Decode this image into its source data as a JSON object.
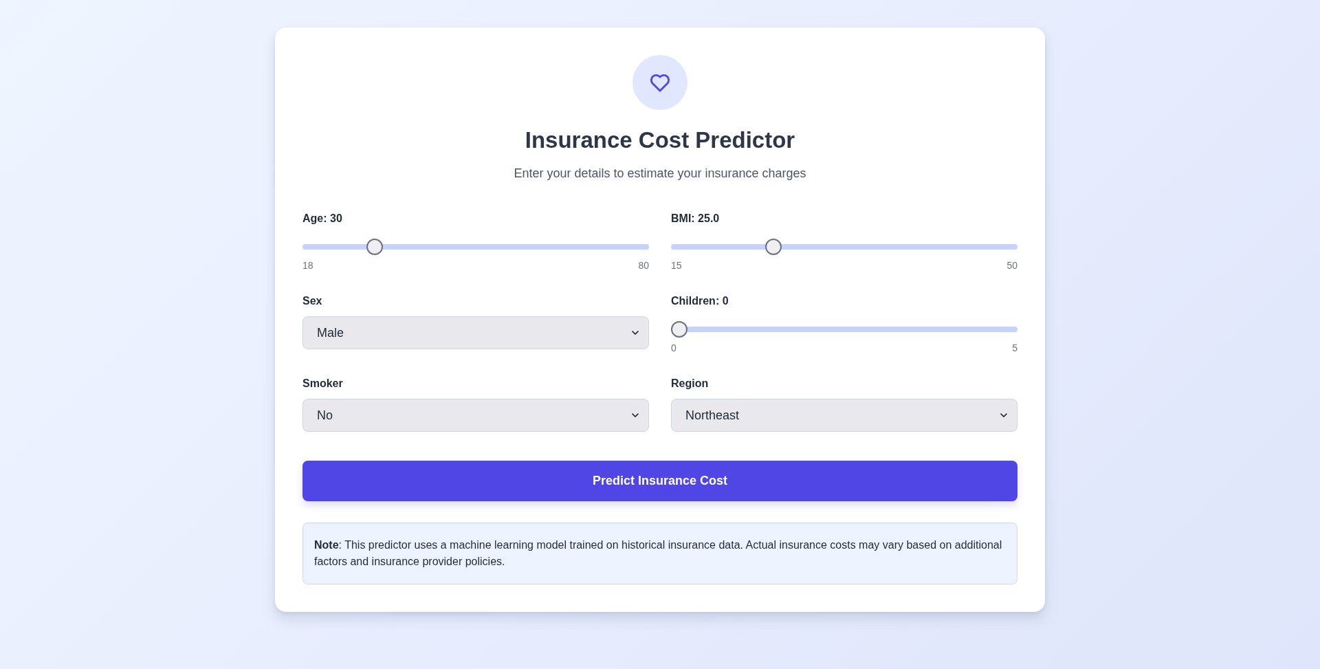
{
  "header": {
    "title": "Insurance Cost Predictor",
    "subtitle": "Enter your details to estimate your insurance charges"
  },
  "fields": [
    {
      "kind": "slider",
      "label": "Age: 30",
      "level": 0.1935,
      "min": "18",
      "max": "80"
    },
    {
      "kind": "slider",
      "label": "BMI: 25.0",
      "level": 0.2857,
      "min": "15",
      "max": "50"
    },
    {
      "kind": "select",
      "label": "Sex",
      "value": "Male"
    },
    {
      "kind": "slider",
      "label": "Children: 0",
      "level": 0,
      "min": "0",
      "max": "5"
    },
    {
      "kind": "select",
      "label": "Smoker",
      "value": "No"
    },
    {
      "kind": "select",
      "label": "Region",
      "value": "Northeast"
    }
  ],
  "button": {
    "label": "Predict Insurance Cost"
  },
  "note": {
    "text": "**Note**: This predictor uses a machine learning model trained on historical insurance data. Actual insurance costs may vary based on additional factors and insurance provider policies."
  }
}
